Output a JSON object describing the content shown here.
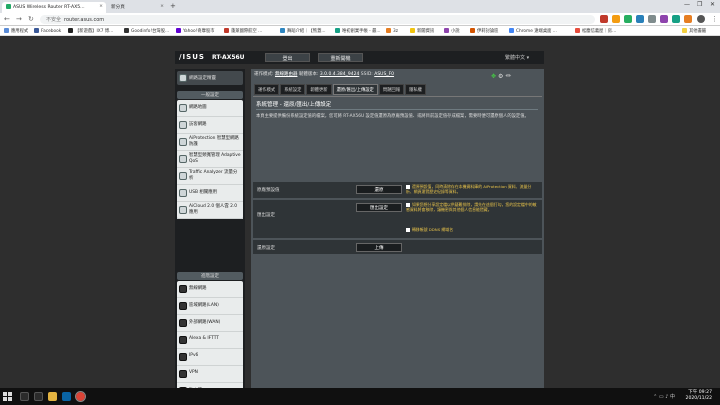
{
  "browser": {
    "active_tab": "ASUS Wireless Router RT-AX5...",
    "inactive_tab": "新分頁",
    "url_prefix": "不安全",
    "url": "router.asus.com",
    "bookmarks": [
      {
        "label": "應用程式",
        "color": "#5a8bd6"
      },
      {
        "label": "Facebook",
        "color": "#3b5998"
      },
      {
        "label": "【新遊戲】IX7 博...",
        "color": "#222222"
      },
      {
        "label": "Goodinfo!台灣股...",
        "color": "#333333"
      },
      {
        "label": "Yahoo!奇摩股市",
        "color": "#6001d2"
      },
      {
        "label": "蓬萊國際航空 ...",
        "color": "#c0392b"
      },
      {
        "label": "舞蹈介紹｜【熊蓋...",
        "color": "#2e86c1"
      },
      {
        "label": "唯初創業手帳 - 最...",
        "color": "#16a085"
      },
      {
        "label": "3z",
        "color": "#e67e22"
      },
      {
        "label": "新聞資訊",
        "color": "#f1c40f"
      },
      {
        "label": "小說",
        "color": "#8e44ad"
      },
      {
        "label": "伊莉討論區",
        "color": "#d35400"
      },
      {
        "label": "Chrome 遠端桌面 ...",
        "color": "#4285f4"
      },
      {
        "label": "松塵信義屋｜房...",
        "color": "#e74c3c"
      },
      {
        "label": "其他書籤",
        "color": "#f4d03f"
      }
    ]
  },
  "router": {
    "logo": "/ISUS",
    "model": "RT-AX56U",
    "logout": "登出",
    "reboot": "重新開機",
    "language": "繁體中文",
    "quick_setup": "網路設定精靈",
    "general_header": "一般設定",
    "general_items": [
      {
        "label": "網路地圖",
        "two": false
      },
      {
        "label": "訪客網路",
        "two": false
      },
      {
        "label": "AiProtection 智慧型網路防護",
        "two": true
      },
      {
        "label": "智慧型頻寬管理 Adaptive QoS",
        "two": true
      },
      {
        "label": "Traffic Analyzer 流量分析",
        "two": true
      },
      {
        "label": "USB 相關應用",
        "two": false
      },
      {
        "label": "AiCloud 2.0 個人雲 2.0 應用",
        "two": true
      }
    ],
    "advanced_header": "進階設定",
    "advanced_items": [
      {
        "label": "無線網路"
      },
      {
        "label": "區域網路(LAN)"
      },
      {
        "label": "外部網路(WAN)"
      },
      {
        "label": "Alexa & IFTTT"
      },
      {
        "label": "IPv6"
      },
      {
        "label": "VPN"
      },
      {
        "label": "防火牆"
      },
      {
        "label": "系統管理"
      }
    ],
    "status": {
      "mode_label": "運作模式:",
      "mode_value": "無線路由器",
      "fw_label": "韌體版本:",
      "fw_value": "3.0.0.4.384_9424",
      "ssid_label": "SSID:",
      "ssid_value": "ASUS_F0"
    },
    "tabs": [
      "運作模式",
      "系統設定",
      "韌體更新",
      "還原/匯出/上傳設定",
      "問題回報",
      "隱私權"
    ],
    "selected_tab": 3,
    "page_title": "系統管理 - 還原/匯出/上傳設定",
    "description": "本頁主要提供備份系統設定值的檔案，您可將 RT-AX56U 設定值還原為原廠預設值、或將目前設定值存成檔案，需要時便可還原個人的設定值。",
    "rows": [
      {
        "label": "原廠預設值",
        "button": "還原",
        "notes": [
          "還原預設值，同時清除存在本機資料庫的 AiProtection 資料、流量分析、網頁瀏覽歷史紀錄等資料。"
        ]
      },
      {
        "label": "匯出設定",
        "button": "匯出設定",
        "notes": [
          "如果您想分享設定檔以供疑難排除，請先在這個打勾，您的設定檔中的敏感資料將會移除，讓機密與其他個人信息能隱藏。",
          "轉移帳號 DDNS 網域名"
        ]
      },
      {
        "label": "還原設定",
        "button": "上傳",
        "notes": []
      }
    ]
  },
  "taskbar": {
    "time": "下午 09:27",
    "date": "2020/11/22"
  }
}
